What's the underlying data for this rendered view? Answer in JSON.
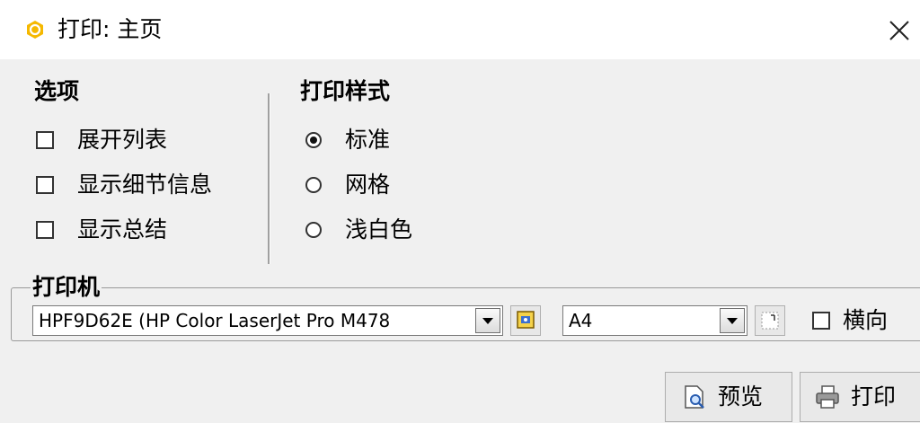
{
  "window": {
    "title": "打印: 主页",
    "close_icon": "close-icon",
    "app_icon": "hexagon-logo-icon"
  },
  "options": {
    "title": "选项",
    "items": [
      {
        "label": "展开列表",
        "checked": false
      },
      {
        "label": "显示细节信息",
        "checked": false
      },
      {
        "label": "显示总结",
        "checked": false
      }
    ]
  },
  "print_style": {
    "title": "打印样式",
    "items": [
      {
        "label": "标准",
        "selected": true
      },
      {
        "label": "网格",
        "selected": false
      },
      {
        "label": "浅白色",
        "selected": false
      }
    ]
  },
  "printer": {
    "group_title": "打印机",
    "selected_printer": "HPF9D62E (HP Color LaserJet Pro M478",
    "printer_props_icon": "printer-properties-icon",
    "paper_size": "A4",
    "page_setup_icon": "page-setup-icon",
    "landscape_label": "横向",
    "landscape_checked": false
  },
  "actions": {
    "preview_label": "预览",
    "preview_icon": "print-preview-icon",
    "print_label": "打印",
    "print_icon": "printer-icon"
  },
  "colors": {
    "background": "#f0f0f0",
    "titlebar": "#ffffff",
    "logo": "#f5b800"
  }
}
